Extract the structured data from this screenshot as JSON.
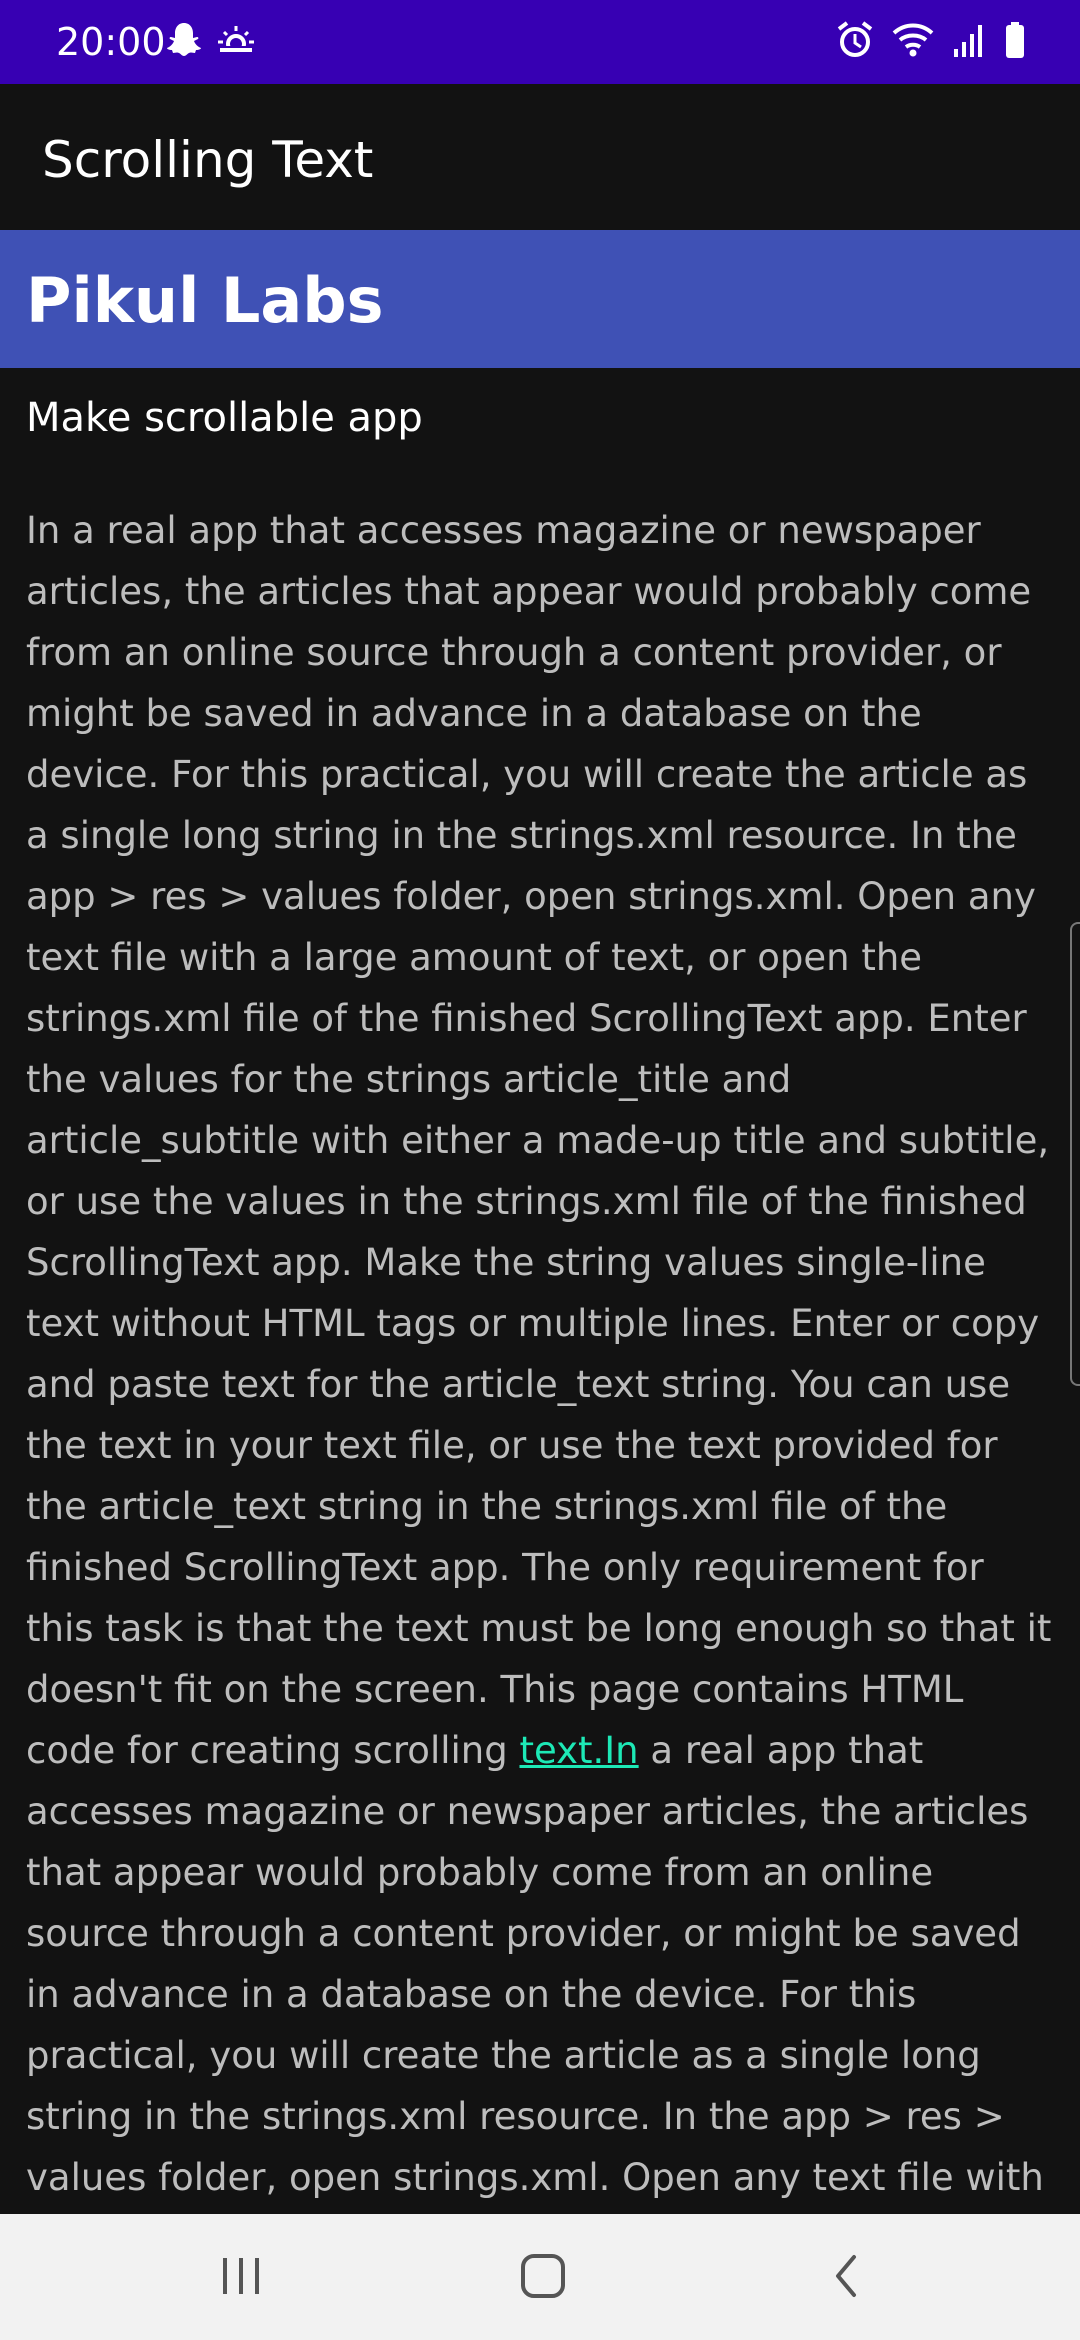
{
  "status_bar": {
    "time": "20:00",
    "background": "#3700b3",
    "left_icons": [
      "snapchat-icon",
      "weather-icon"
    ],
    "right_icons": [
      "alarm-icon",
      "wifi-icon",
      "signal-icon",
      "battery-icon"
    ]
  },
  "app_bar": {
    "title": "Scrolling Text"
  },
  "article": {
    "title": "Pikul Labs",
    "title_background": "#3f51b5",
    "subtitle": "Make scrollable app",
    "body_before_link": " In a real app that accesses magazine or newspaper articles, the articles that appear would probably come from an online source through a content provider, or might be saved in advance in a database on the device. For this practical, you will create the article as a single long string in the strings.xml resource. In the app > res > values folder, open strings.xml. Open any text file with a large amount of text, or open the strings.xml file of the finished ScrollingText app. Enter the values for the strings article_title and article_subtitle with either a made-up title and subtitle, or use the values in the strings.xml file of the finished ScrollingText app. Make the string values single-line text without HTML tags or multiple lines. Enter or copy and paste text for the article_text string. You can use the text in your text file, or use the text provided for the article_text string in the strings.xml file of the finished ScrollingText app. The only requirement for this task is that the text must be long enough so that it doesn't fit on the screen. This page contains HTML code for creating scrolling ",
    "link_text": "text.In",
    "body_after_link": " a real app that accesses magazine or newspaper articles, the articles that appear would probably come from an online source through a content provider, or might be saved in advance in a database on the device. For this practical, you will create the article as a single long string in the strings.xml resource. In the app > res > values folder, open strings.xml. Open any text file with a large amount of text, or open the strings.xml file of the finished ScrollingText app. Enter",
    "link_color": "#1de9b6"
  },
  "nav_bar": {
    "buttons": [
      "recents-icon",
      "home-icon",
      "back-icon"
    ]
  }
}
